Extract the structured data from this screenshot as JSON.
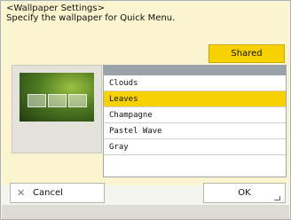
{
  "dialog": {
    "title": "<Wallpaper Settings>",
    "instruction": "Specify the wallpaper for Quick Menu."
  },
  "shared_label": "Shared",
  "wallpapers": [
    "Clouds",
    "Leaves",
    "Champagne",
    "Pastel Wave",
    "Gray"
  ],
  "selected_wallpaper": "Leaves",
  "buttons": {
    "cancel": "Cancel",
    "ok": "OK"
  },
  "colors": {
    "accent": "#f7d200",
    "panel": "#fbf5cf"
  },
  "icons": {
    "cancel": "close-icon",
    "ok": "enter-corner-icon"
  }
}
